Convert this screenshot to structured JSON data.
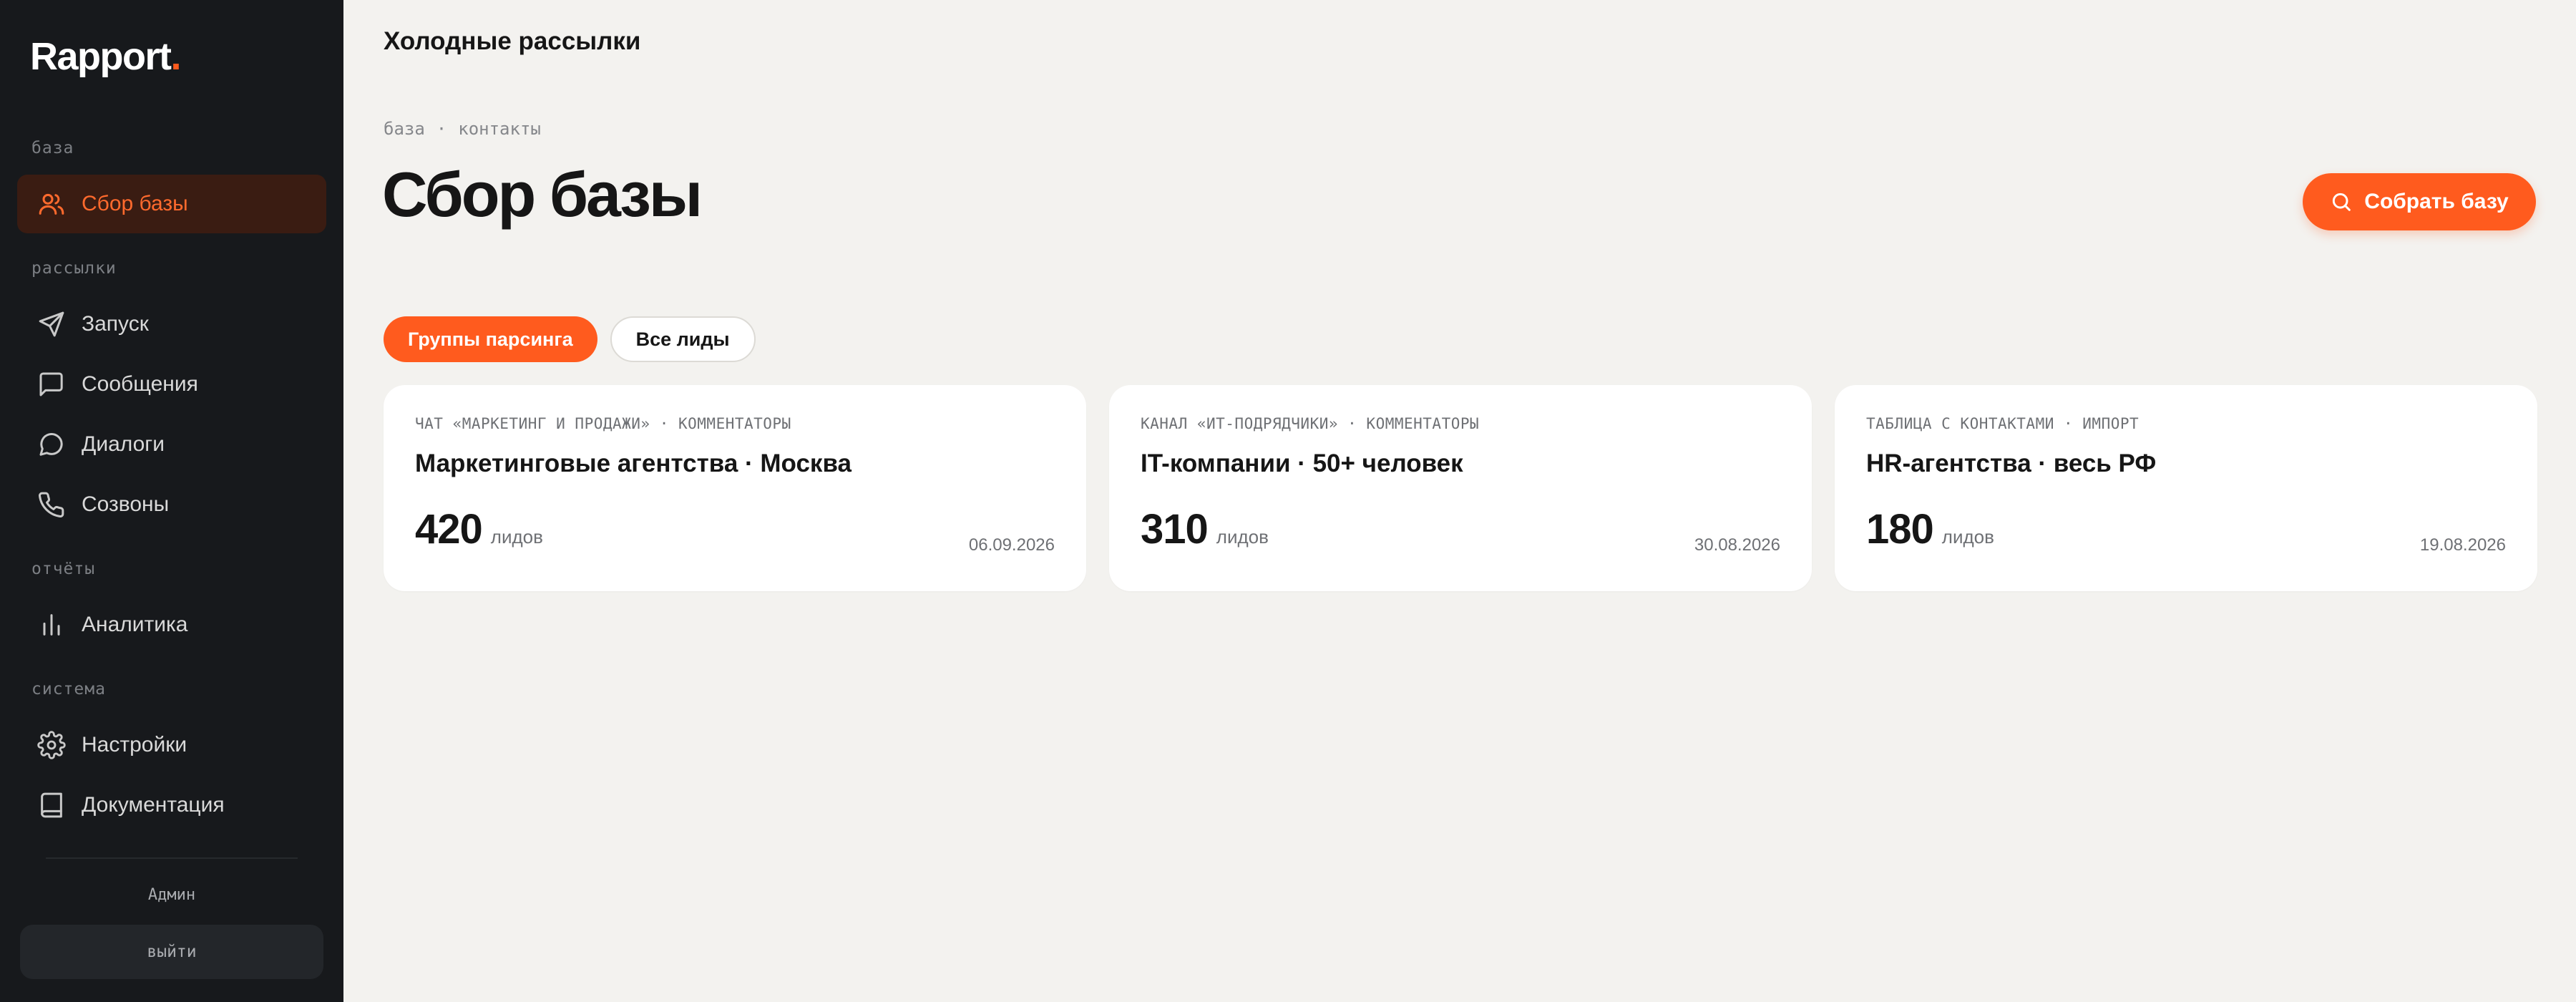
{
  "brand": {
    "name": "Rapport",
    "dot": "."
  },
  "sidebar": {
    "sections": [
      {
        "title": "база"
      },
      {
        "title": "рассылки"
      },
      {
        "title": "отчёты"
      },
      {
        "title": "система"
      }
    ],
    "items": [
      {
        "label": "Сбор базы",
        "icon": "users-icon",
        "active": true
      },
      {
        "label": "Запуск",
        "icon": "send-icon"
      },
      {
        "label": "Сообщения",
        "icon": "message-square-icon"
      },
      {
        "label": "Диалоги",
        "icon": "message-circle-icon"
      },
      {
        "label": "Созвоны",
        "icon": "phone-icon"
      },
      {
        "label": "Аналитика",
        "icon": "bar-chart-icon"
      },
      {
        "label": "Настройки",
        "icon": "gear-icon"
      },
      {
        "label": "Документация",
        "icon": "book-icon"
      }
    ],
    "user": "Админ",
    "logout_label": "выйти"
  },
  "header": {
    "title": "Холодные рассылки"
  },
  "breadcrumb": [
    "база",
    "·",
    "контакты"
  ],
  "page": {
    "title": "Сбор базы",
    "primary_action": "Собрать базу"
  },
  "tabs": [
    {
      "label": "Группы парсинга",
      "active": true
    },
    {
      "label": "Все лиды",
      "active": false
    }
  ],
  "cards": [
    {
      "source": "ЧАТ «МАРКЕТИНГ И ПРОДАЖИ» · КОММЕНТАТОРЫ",
      "title": "Маркетинговые агентства · Москва",
      "count": "420",
      "unit": "лидов",
      "date": "06.09.2026"
    },
    {
      "source": "КАНАЛ «ИТ-ПОДРЯДЧИКИ» · КОММЕНТАТОРЫ",
      "title": "IT-компании · 50+ человек",
      "count": "310",
      "unit": "лидов",
      "date": "30.08.2026"
    },
    {
      "source": "ТАБЛИЦА С КОНТАКТАМИ · ИМПОРТ",
      "title": "HR-агентства · весь РФ",
      "count": "180",
      "unit": "лидов",
      "date": "19.08.2026"
    }
  ],
  "colors": {
    "accent": "#ff5b1e",
    "sidebar_bg": "#17191c",
    "active_item_bg": "#3a1c12",
    "page_bg": "#f3f2ef"
  }
}
